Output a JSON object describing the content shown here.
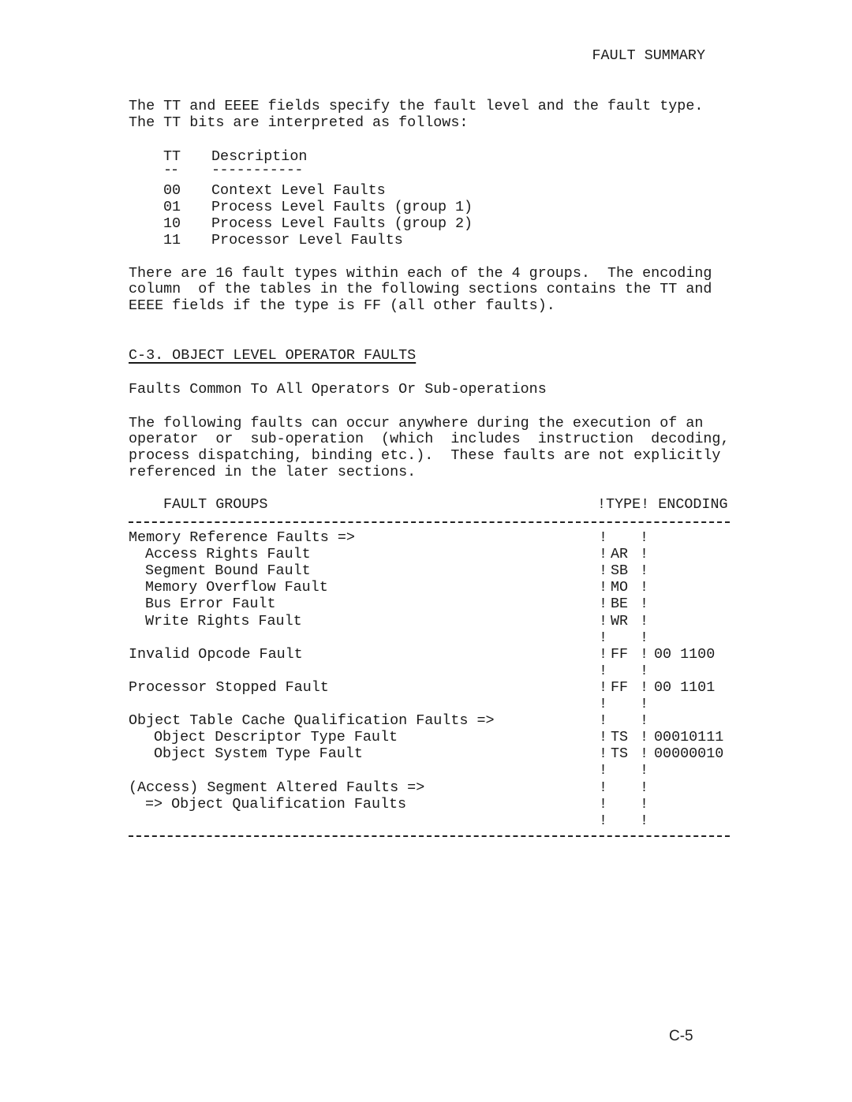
{
  "header": {
    "running_title": "FAULT SUMMARY"
  },
  "intro": {
    "lines": [
      "The TT and EEEE fields specify the fault level and the fault type.",
      "The TT bits are interpreted as follows:"
    ]
  },
  "tt_table": {
    "headers": {
      "code": "TT",
      "description": "Description"
    },
    "underline_code": "--",
    "underline_desc": "-----------",
    "rows": [
      {
        "code": "00",
        "description": "Context Level Faults"
      },
      {
        "code": "01",
        "description": "Process Level Faults (group 1)"
      },
      {
        "code": "10",
        "description": "Process Level Faults (group 2)"
      },
      {
        "code": "11",
        "description": "Processor Level Faults"
      }
    ]
  },
  "encoding_note": {
    "lines": [
      "There are 16 fault types within each of the 4 groups.  The encoding",
      "column  of the tables in the following sections contains the TT and",
      "EEEE fields if the type is FF (all other faults)."
    ]
  },
  "section": {
    "title": "C-3. OBJECT LEVEL OPERATOR FAULTS",
    "subtitle": "Faults Common To All Operators Or Sub-operations",
    "paragraph": [
      "The following faults can occur anywhere during the execution of an",
      "operator  or  sub-operation  (which  includes  instruction  decoding,",
      "process dispatching, binding etc.).  These faults are not explicitly",
      "referenced in the later sections."
    ]
  },
  "fault_table": {
    "headers": {
      "groups": "FAULT GROUPS",
      "type_encoding": "!TYPE! ENCODING"
    },
    "separator": "!",
    "rows": [
      {
        "label": "Memory Reference Faults =>",
        "indent": 0,
        "type": "",
        "encoding": ""
      },
      {
        "label": "Access Rights Fault",
        "indent": 1,
        "type": "AR",
        "encoding": ""
      },
      {
        "label": "Segment Bound Fault",
        "indent": 1,
        "type": "SB",
        "encoding": ""
      },
      {
        "label": "Memory Overflow Fault",
        "indent": 1,
        "type": "MO",
        "encoding": ""
      },
      {
        "label": "Bus Error Fault",
        "indent": 1,
        "type": "BE",
        "encoding": ""
      },
      {
        "label": "Write Rights Fault",
        "indent": 1,
        "type": "WR",
        "encoding": ""
      },
      {
        "label": "",
        "indent": 0,
        "type": "",
        "encoding": ""
      },
      {
        "label": "Invalid Opcode Fault",
        "indent": 0,
        "type": "FF",
        "encoding": "00 1100"
      },
      {
        "label": "",
        "indent": 0,
        "type": "",
        "encoding": ""
      },
      {
        "label": "Processor Stopped Fault",
        "indent": 0,
        "type": "FF",
        "encoding": "00 1101"
      },
      {
        "label": "",
        "indent": 0,
        "type": "",
        "encoding": ""
      },
      {
        "label": "Object Table Cache Qualification Faults =>",
        "indent": 0,
        "type": "",
        "encoding": ""
      },
      {
        "label": "Object Descriptor Type Fault",
        "indent": 2,
        "type": "TS",
        "encoding": "00010111"
      },
      {
        "label": "Object System Type Fault",
        "indent": 2,
        "type": "TS",
        "encoding": "00000010"
      },
      {
        "label": "",
        "indent": 0,
        "type": "",
        "encoding": ""
      },
      {
        "label": "(Access) Segment Altered Faults =>",
        "indent": 0,
        "type": "",
        "encoding": ""
      },
      {
        "label": "=> Object Qualification Faults",
        "indent": 1,
        "type": "",
        "encoding": ""
      },
      {
        "label": "",
        "indent": 0,
        "type": "",
        "encoding": ""
      }
    ]
  },
  "footer": {
    "page_number": "C-5"
  }
}
